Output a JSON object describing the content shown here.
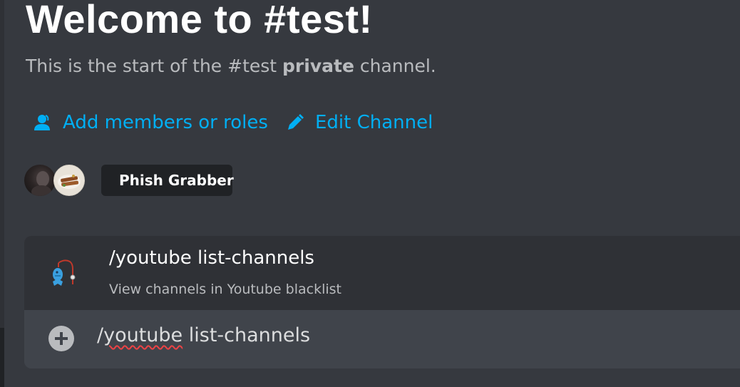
{
  "welcome": {
    "title": "Welcome to #test!",
    "subtitle_prefix": "This is the start of the #test ",
    "subtitle_bold": "private",
    "subtitle_suffix": " channel."
  },
  "actions": {
    "add_members_label": "Add members or roles",
    "add_members_icon": "person-icon",
    "edit_channel_label": "Edit Channel",
    "edit_channel_icon": "pencil-icon",
    "link_color": "#00aff4"
  },
  "members": {
    "bot_name": "Phish Grabber",
    "bot_status": "offline"
  },
  "command_suggestion": {
    "name": "/youtube list-channels",
    "description": "View channels in Youtube blacklist",
    "bot_icon": "fish-hook-bot-icon"
  },
  "message_input": {
    "prefix": "/",
    "misspelled_word": "youtube",
    "rest": " list-channels",
    "attach_icon": "plus-circle-icon"
  },
  "colors": {
    "background": "#36393f",
    "panel": "#2f3136",
    "input": "#40444b",
    "chip": "#202225"
  }
}
